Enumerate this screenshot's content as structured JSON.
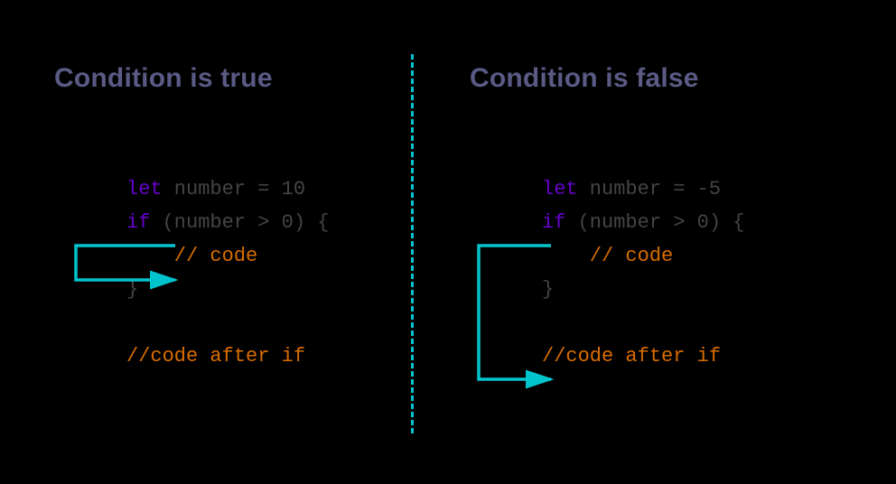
{
  "left": {
    "heading": "Condition is true",
    "code": {
      "l1_kw": "let",
      "l1_rest": " number = 10",
      "l2_kw": "if",
      "l2_rest": " (number > 0) {",
      "l3": "    // code",
      "l4": "}",
      "l5": "",
      "l6": "//code after if"
    }
  },
  "right": {
    "heading": "Condition is false",
    "code": {
      "l1_kw": "let",
      "l1_rest": " number = -5",
      "l2_kw": "if",
      "l2_rest": " (number > 0) {",
      "l3": "    // code",
      "l4": "}",
      "l5": "",
      "l6": "//code after if"
    }
  },
  "colors": {
    "arrow": "#00c4cc",
    "divider": "#00c4cc",
    "heading": "#5a5a85",
    "keyword": "#6600cc",
    "identifier": "#444444",
    "comment": "#d96d00",
    "background": "#000000"
  }
}
